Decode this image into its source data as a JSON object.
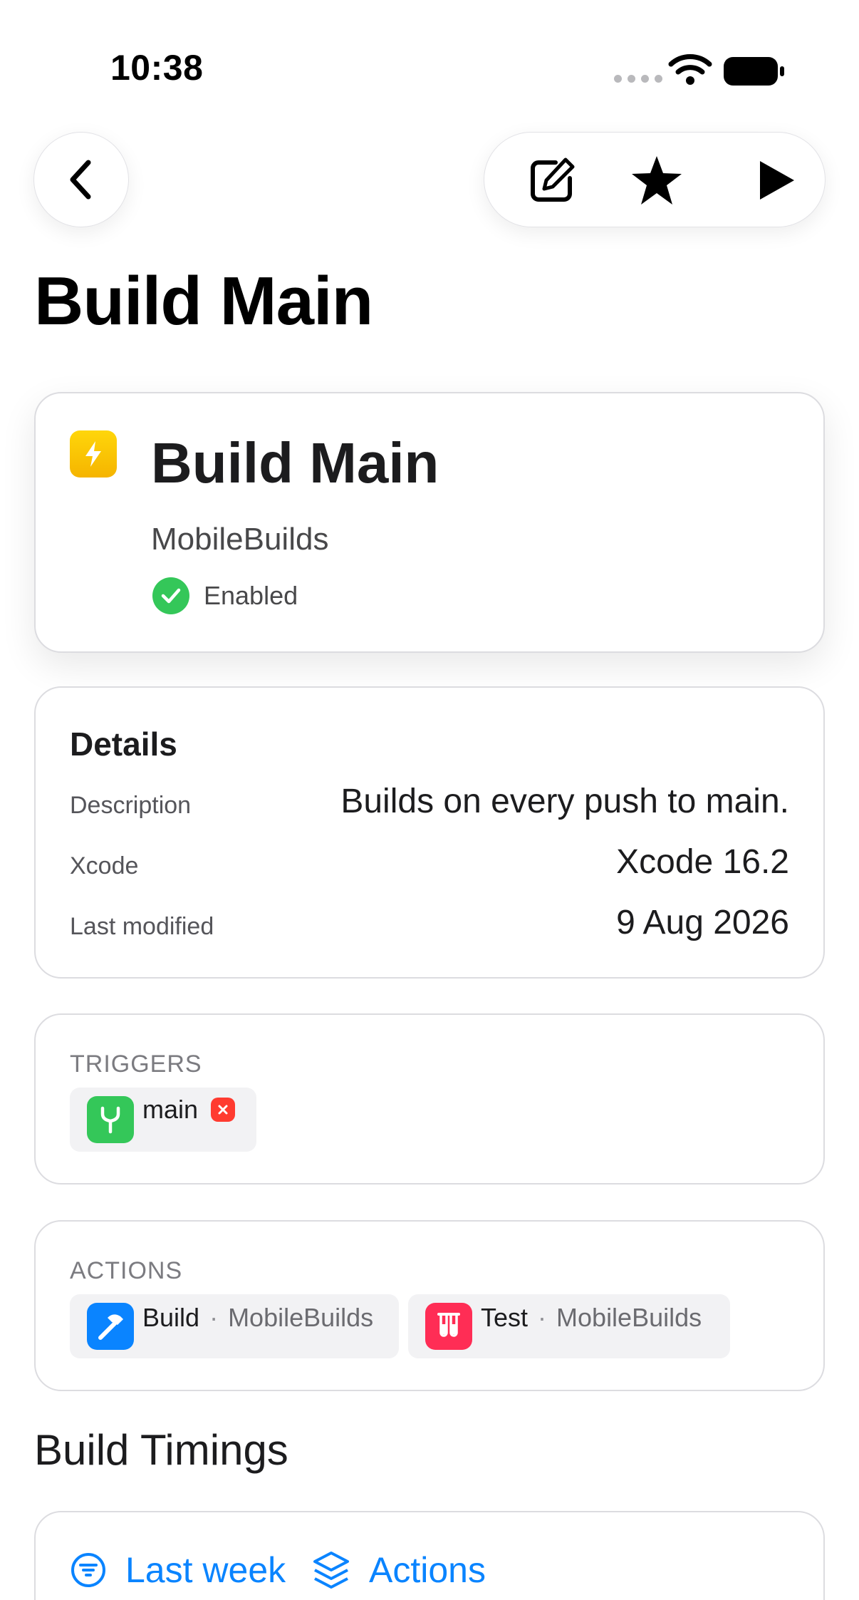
{
  "status_bar": {
    "time": "10:38"
  },
  "nav": {
    "back_icon": "chevron-left-icon",
    "actions": [
      "edit-icon",
      "star-icon",
      "play-icon"
    ]
  },
  "page": {
    "title": "Build Main"
  },
  "hero": {
    "title": "Build Main",
    "subtitle": "MobileBuilds",
    "status": "Enabled",
    "badge_color": "#FFC400",
    "status_color": "#34C759"
  },
  "details": {
    "heading": "Details",
    "rows": [
      {
        "label": "Description",
        "value": "Builds on every push to main."
      },
      {
        "label": "Xcode",
        "value": "Xcode 16.2"
      },
      {
        "label": "Last modified",
        "value": "9 Aug 2026"
      }
    ]
  },
  "triggers": {
    "label": "TRIGGERS",
    "items": [
      {
        "name": "main",
        "icon": "branch-icon",
        "color": "#34C759"
      }
    ]
  },
  "actions": {
    "label": "ACTIONS",
    "items": [
      {
        "name": "Build",
        "separator": "·",
        "repo": "MobileBuilds",
        "icon": "hammer-icon",
        "color": "#0A84FF"
      },
      {
        "name": "Test",
        "separator": "·",
        "repo": "MobileBuilds",
        "icon": "test-tubes-icon",
        "color": "#FF2D55"
      }
    ]
  },
  "timings": {
    "heading": "Build Timings",
    "filters": [
      {
        "label": "Last week",
        "icon": "filter-icon"
      },
      {
        "label": "Actions",
        "icon": "stack-icon"
      }
    ],
    "accent": "#0A84FF"
  }
}
